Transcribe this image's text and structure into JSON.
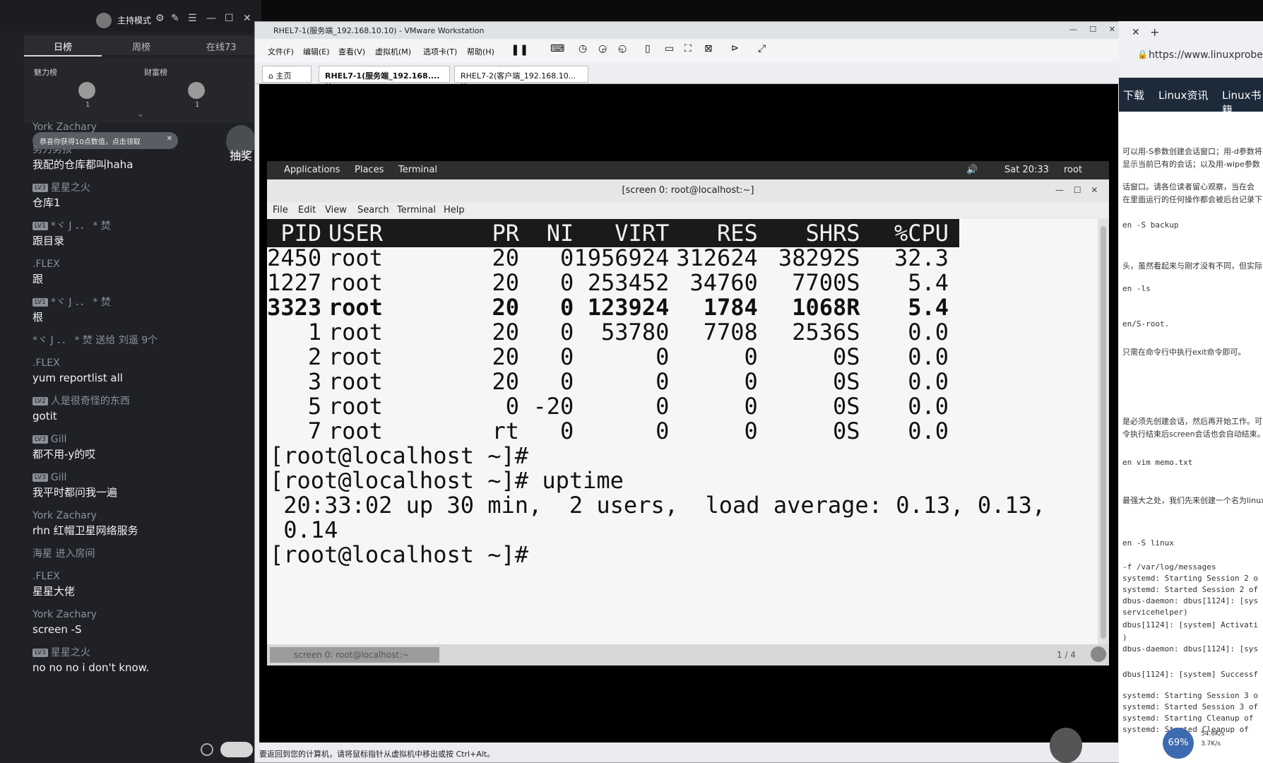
{
  "chat": {
    "title": "主持模式",
    "tabs": [
      "日榜",
      "周榜",
      "在线73"
    ],
    "rank": {
      "left_label": "魅力榜",
      "right_label": "财富榜",
      "left_rank": "1",
      "right_rank": "1"
    },
    "toast": "恭喜你获得10点数值，点击领取",
    "lottery": "抽奖",
    "messages": [
      {
        "user": "York Zachary",
        "level": "",
        "text": ""
      },
      {
        "user": "努力男孩",
        "level": "",
        "text": "我配的仓库都叫haha"
      },
      {
        "user": "星星之火",
        "level": "LV3",
        "text": "仓库1"
      },
      {
        "user": "*ヾ J ．． * 焚",
        "level": "LV1",
        "text": "跟目录"
      },
      {
        "user": ".FLEX",
        "level": "",
        "text": "跟"
      },
      {
        "user": "*ヾ J ．． * 焚",
        "level": "LV1",
        "text": "根"
      },
      {
        "user": "*ヾ J ．． * 焚 送给 刘遥 9个",
        "level": "",
        "text": ""
      },
      {
        "user": ".FLEX",
        "level": "",
        "text": "yum reportlist all"
      },
      {
        "user": "人是很奇怪的东西",
        "level": "LV2",
        "text": "gotit"
      },
      {
        "user": "Gill",
        "level": "LV3",
        "text": "都不用-y的哎"
      },
      {
        "user": "Gill",
        "level": "LV3",
        "text": "我平时都问我一遍"
      },
      {
        "user": "York Zachary",
        "level": "",
        "text": "rhn 红帽卫星网络服务"
      },
      {
        "user": "海星 进入房间",
        "level": "",
        "text": ""
      },
      {
        "user": ".FLEX",
        "level": "",
        "text": "星星大佬"
      },
      {
        "user": "York Zachary",
        "level": "",
        "text": "screen -S"
      },
      {
        "user": "星星之火",
        "level": "LV3",
        "text": "no no no i don't know."
      }
    ]
  },
  "vmware": {
    "title": "RHEL7-1(服务端_192.168.10.10) - VMware Workstation",
    "menu": [
      "文件(F)",
      "编辑(E)",
      "查看(V)",
      "虚拟机(M)",
      "选项卡(T)",
      "帮助(H)"
    ],
    "tabs": [
      "主页",
      "RHEL7-1(服务端_192.168....",
      "RHEL7-2(客户端_192.168.10..."
    ],
    "status": "要返回到您的计算机，请将鼠标指针从虚拟机中移出或按 Ctrl+Alt。"
  },
  "guest": {
    "applications": "Applications",
    "places": "Places",
    "terminal_tab": "Terminal",
    "time": "Sat 20:33",
    "user": "root",
    "term_title": "[screen 0: root@localhost:~]",
    "term_menu": [
      "File",
      "Edit",
      "View",
      "Search",
      "Terminal",
      "Help"
    ],
    "bottom_label": "screen 0: root@localhost:~",
    "page_indicator": "1 / 4"
  },
  "top": {
    "headers": [
      "PID",
      "USER",
      "PR",
      "NI",
      "VIRT",
      "RES",
      "SHR",
      "S",
      "%CPU"
    ],
    "rows": [
      [
        "2450",
        "root",
        "20",
        "0",
        "1956924",
        "312624",
        "38292",
        "S",
        "32.3"
      ],
      [
        "1227",
        "root",
        "20",
        "0",
        "253452",
        "34760",
        "7700",
        "S",
        "5.4"
      ],
      [
        "3323",
        "root",
        "20",
        "0",
        "123924",
        "1784",
        "1068",
        "R",
        "5.4"
      ],
      [
        "1",
        "root",
        "20",
        "0",
        "53780",
        "7708",
        "2536",
        "S",
        "0.0"
      ],
      [
        "2",
        "root",
        "20",
        "0",
        "0",
        "0",
        "0",
        "S",
        "0.0"
      ],
      [
        "3",
        "root",
        "20",
        "0",
        "0",
        "0",
        "0",
        "S",
        "0.0"
      ],
      [
        "5",
        "root",
        "0",
        "-20",
        "0",
        "0",
        "0",
        "S",
        "0.0"
      ],
      [
        "7",
        "root",
        "rt",
        "0",
        "0",
        "0",
        "0",
        "S",
        "0.0"
      ]
    ],
    "bold_row": 2
  },
  "shell": {
    "lines": [
      "[root@localhost ~]#",
      "[root@localhost ~]# uptime",
      " 20:33:02 up 30 min,  2 users,  load average: 0.13, 0.13,",
      " 0.14",
      "[root@localhost ~]#"
    ]
  },
  "browser": {
    "url": "https://www.linuxprobe.co",
    "nav": [
      "下载",
      "Linux资讯",
      "Linux书籍"
    ],
    "lines": [
      "可以用-S参数创建会话窗口；用-d参数将",
      "显示当前已有的会话；以及用-wipe参数",
      "话窗口。请各位读者留心观察，当在会",
      "在里面运行的任何操作都会被后台记录下",
      "en -S backup",
      "头，虽然看起来与刚才没有不同，但实际",
      "en -ls",
      "en/S-root.",
      "只需在命令行中执行exit命令即可。",
      "是必须先创建会话，然后再开始工作。可",
      "令执行结束后screen会话也会自动结束。",
      "en vim memo.txt",
      "最强大之处，我们先来创建一个名为linux",
      "en -S linux",
      "-f /var/log/messages",
      "systemd: Starting Session 2 o",
      "systemd: Started Session 2 of",
      "dbus-daemon: dbus[1124]: [sys",
      "servicehelper)",
      "dbus[1124]: [system] Activati",
      ")",
      "dbus-daemon: dbus[1124]: [sys",
      "dbus[1124]: [system] Successf",
      "systemd: Starting Session 3 o",
      "systemd: Started Session 3 of",
      "systemd: Starting Cleanup of",
      "systemd: Started Cleanup of"
    ],
    "net_up": "54.6K/s",
    "net_down": "3.7K/s",
    "battery": "69%"
  }
}
